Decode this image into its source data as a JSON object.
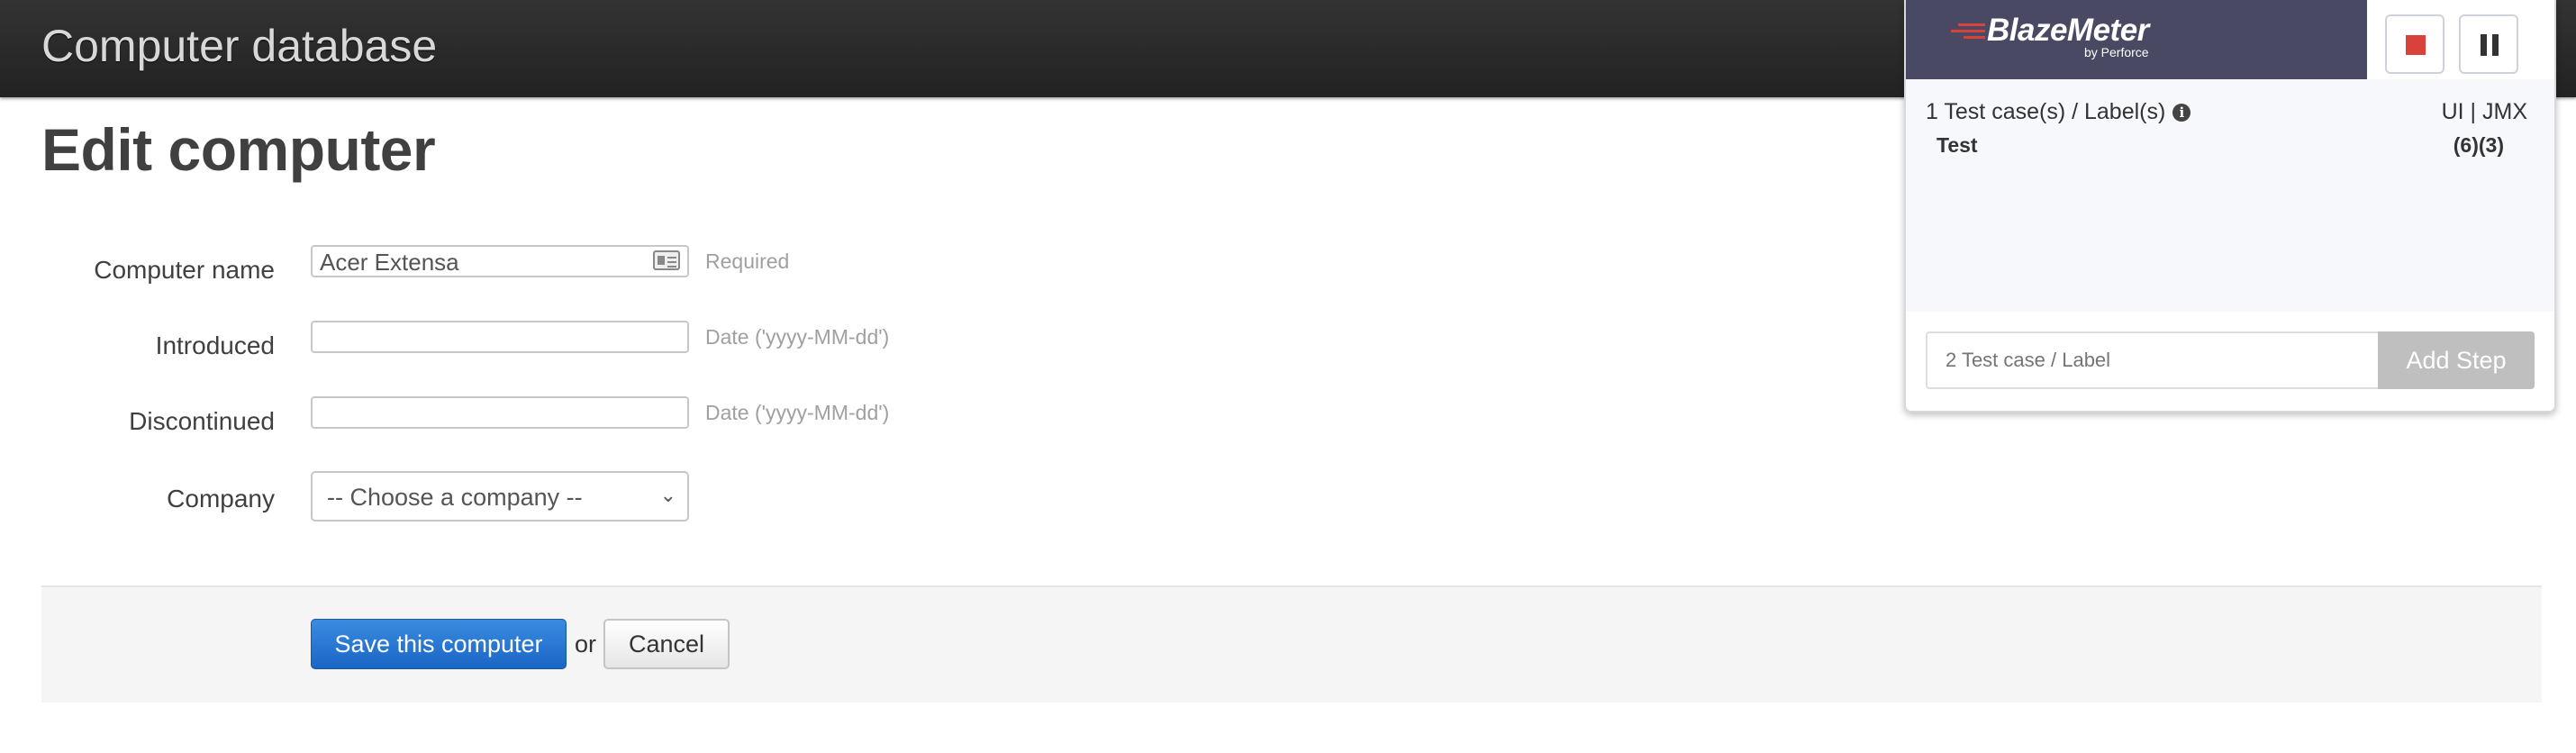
{
  "header": {
    "title": "Computer database"
  },
  "page": {
    "title": "Edit computer"
  },
  "form": {
    "computer_name": {
      "label": "Computer name",
      "value": "Acer Extensa",
      "hint": "Required"
    },
    "introduced": {
      "label": "Introduced",
      "value": "",
      "hint": "Date ('yyyy-MM-dd')"
    },
    "discontinued": {
      "label": "Discontinued",
      "value": "",
      "hint": "Date ('yyyy-MM-dd')"
    },
    "company": {
      "label": "Company",
      "selected": "-- Choose a company --"
    }
  },
  "actions": {
    "save_label": "Save this computer",
    "or_text": "or",
    "cancel_label": "Cancel"
  },
  "blazemeter": {
    "logo_name": "BlazeMeter",
    "logo_sub": "by Perforce",
    "count_label": "1 Test case(s) / Label(s)",
    "toggle_label": "UI | JMX",
    "items": [
      {
        "name": "Test",
        "counts": "(6)(3)"
      }
    ],
    "input_placeholder": "2 Test case / Label",
    "add_label": "Add Step",
    "colors": {
      "header": "#494963",
      "stop": "#d9423a",
      "add_disabled": "#bfbfbf"
    }
  },
  "colors": {
    "primary": "#1a66c5",
    "topbar": "#2a2a2a"
  }
}
